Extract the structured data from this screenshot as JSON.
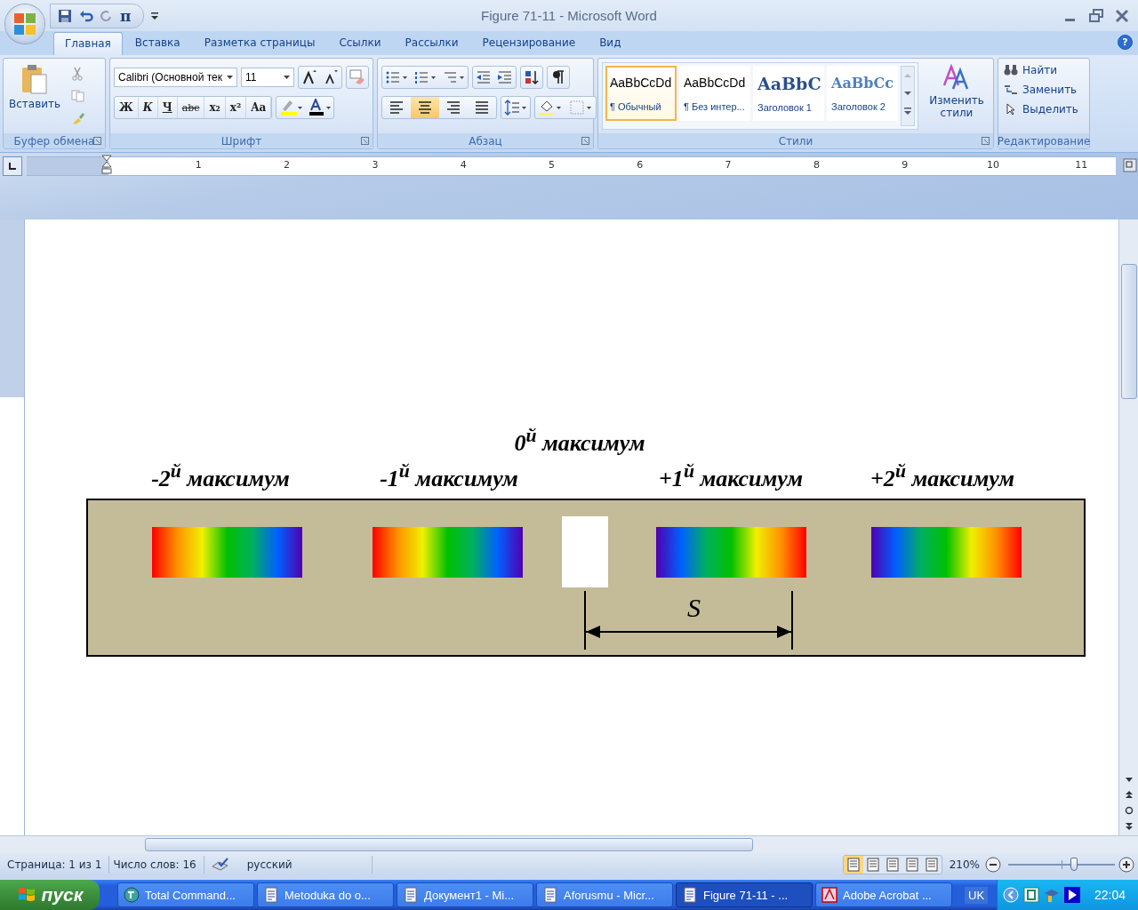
{
  "window": {
    "title": "Figure 71-11 - Microsoft Word"
  },
  "quick_access": {
    "symbol": "π"
  },
  "help": "?",
  "tabs": [
    {
      "label": "Главная",
      "selected": true
    },
    {
      "label": "Вставка",
      "selected": false
    },
    {
      "label": "Разметка страницы",
      "selected": false
    },
    {
      "label": "Ссылки",
      "selected": false
    },
    {
      "label": "Рассылки",
      "selected": false
    },
    {
      "label": "Рецензирование",
      "selected": false
    },
    {
      "label": "Вид",
      "selected": false
    }
  ],
  "ribbon": {
    "clipboard": {
      "label": "Буфер обмена",
      "paste": "Вставить"
    },
    "font": {
      "label": "Шрифт",
      "font_name": "Calibri (Основной тек",
      "font_size": "11",
      "format_buttons": [
        "Ж",
        "К",
        "Ч",
        "abc",
        "x₂",
        "x²",
        "Aa"
      ]
    },
    "paragraph": {
      "label": "Абзац",
      "alignments": [
        {
          "selected": false
        },
        {
          "selected": true
        },
        {
          "selected": false
        },
        {
          "selected": false
        }
      ]
    },
    "styles": {
      "label": "Стили",
      "items": [
        {
          "sample": "AaBbCcDd",
          "name": "¶ Обычный",
          "kind": "normal",
          "selected": true
        },
        {
          "sample": "AaBbCcDd",
          "name": "¶ Без интер...",
          "kind": "normal",
          "selected": false
        },
        {
          "sample": "AaBbC",
          "name": "Заголовок 1",
          "kind": "heading1",
          "selected": false
        },
        {
          "sample": "AaBbCc",
          "name": "Заголовок 2",
          "kind": "heading2",
          "selected": false
        }
      ],
      "change_styles": "Изменить стили"
    },
    "editing": {
      "label": "Редактирование",
      "items": [
        {
          "label": "Найти",
          "kind": "find"
        },
        {
          "label": "Заменить",
          "kind": "replace"
        },
        {
          "label": "Выделить",
          "kind": "select"
        }
      ]
    }
  },
  "ruler": {
    "numbers": [
      "1",
      "2",
      "3",
      "4",
      "5",
      "6",
      "7",
      "8",
      "9",
      "10",
      "11"
    ]
  },
  "figure": {
    "zero_label": "0$^{й}$ максимум",
    "bands": [
      {
        "label": "-2$^{й}$ максимум",
        "kind": "red-to-violet"
      },
      {
        "label": "-1$^{й}$ максимум",
        "kind": "red-to-violet"
      },
      {
        "label": "+1$^{й}$ максимум",
        "kind": "violet-to-red"
      },
      {
        "label": "+2$^{й}$ максимум",
        "kind": "violet-to-red"
      }
    ],
    "distance_label": "S"
  },
  "status_bar": {
    "page": "Страница: 1 из 1",
    "words": "Число слов: 16",
    "language": "русский",
    "views": [
      {
        "selected": true
      },
      {
        "selected": false
      },
      {
        "selected": false
      },
      {
        "selected": false
      },
      {
        "selected": false
      }
    ],
    "zoom": "210%",
    "zoom_level": {
      "level": 0.62
    }
  },
  "taskbar": {
    "start": "пуск",
    "items": [
      {
        "label": "Total Command...",
        "kind": "commander",
        "selected": false
      },
      {
        "label": "Metoduka do o...",
        "kind": "word",
        "selected": false
      },
      {
        "label": "Документ1 - Mi...",
        "kind": "word",
        "selected": false
      },
      {
        "label": "Aforusmu - Micr...",
        "kind": "word",
        "selected": false
      },
      {
        "label": "Figure 71-11 - ...",
        "kind": "word",
        "selected": true
      },
      {
        "label": "Adobe Acrobat ...",
        "kind": "pdf",
        "selected": false
      }
    ],
    "language": "UK",
    "clock": "22:04"
  }
}
